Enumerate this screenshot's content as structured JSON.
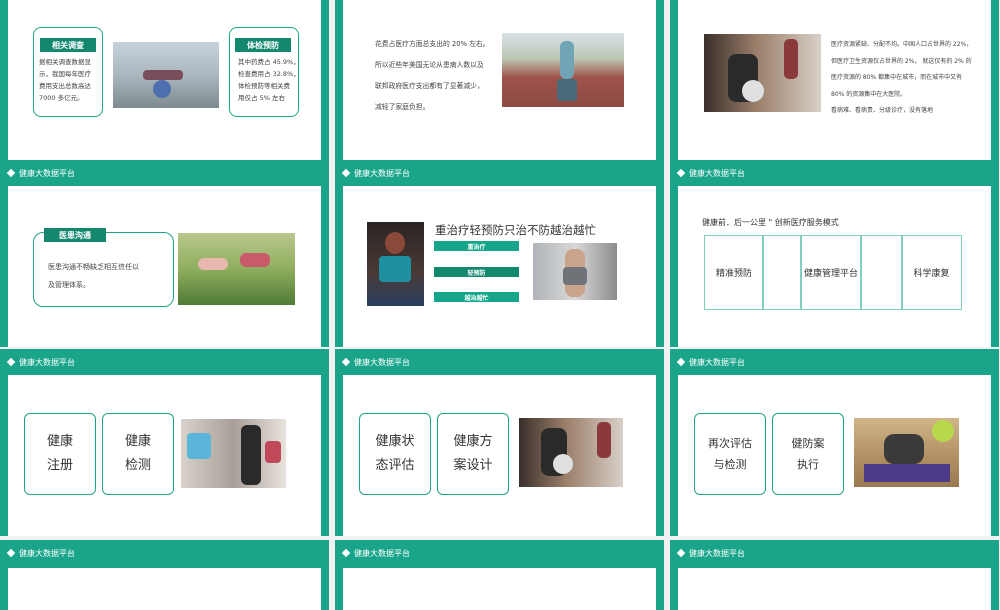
{
  "header_label": "健康大数据平台",
  "slide1": {
    "tag_left": "相关调查",
    "text_left": [
      "据相关调查数据显",
      "示，我国每年医疗",
      "费用支出总数高达",
      "7000 多亿元。"
    ],
    "tag_right": "体检预防",
    "text_right": [
      "其中药费占 45.9%，",
      "检查费用占 32.8%，",
      "体检预防等相关费",
      "用仅占 5% 左右"
    ]
  },
  "slide2": {
    "text": [
      "花费占医疗方面总支出的 20% 左右。",
      "所以近些年美国无论从患病人数以及",
      "联邦政府医疗支出都有了显著减少，",
      "减轻了家庭负担。"
    ]
  },
  "slide3": {
    "text": [
      "医疗资源紧缺、分配不均。中国人口占世界的 22%，",
      "但医疗卫生资源仅占世界的 2%，  就这仅有的 2% 的",
      "医疗资源的 80% 都集中在城市，而在城市中又有",
      "80% 的资源集中在大医院。",
      "看病难、看病贵、分级诊疗，没有落地"
    ]
  },
  "slide4": {
    "tag": "医患沟通",
    "text": [
      "医患沟通不畅缺乏相互信任以",
      "及管理体系。"
    ]
  },
  "slide5": {
    "title": "重治疗轻预防只治不防越治越忙",
    "bars": [
      "重治疗",
      "轻预防",
      "越治越忙"
    ]
  },
  "slide6": {
    "title": "健康前．后一公里 \" 创新医疗服务模式",
    "cells": [
      "精准预防",
      "健康管理平台",
      "科学康复"
    ]
  },
  "slide7": {
    "box1": [
      "健康",
      "注册"
    ],
    "box2": [
      "健康",
      "检测"
    ]
  },
  "slide8": {
    "box1": [
      "健康状",
      "态评估"
    ],
    "box2": [
      "健康方",
      "案设计"
    ]
  },
  "slide9": {
    "box1": [
      "再次评估",
      "与检测"
    ],
    "box2": [
      "健防案",
      "执行"
    ]
  },
  "colors": {
    "brand_green": "#1aa58a",
    "dark_green": "#14876f"
  }
}
